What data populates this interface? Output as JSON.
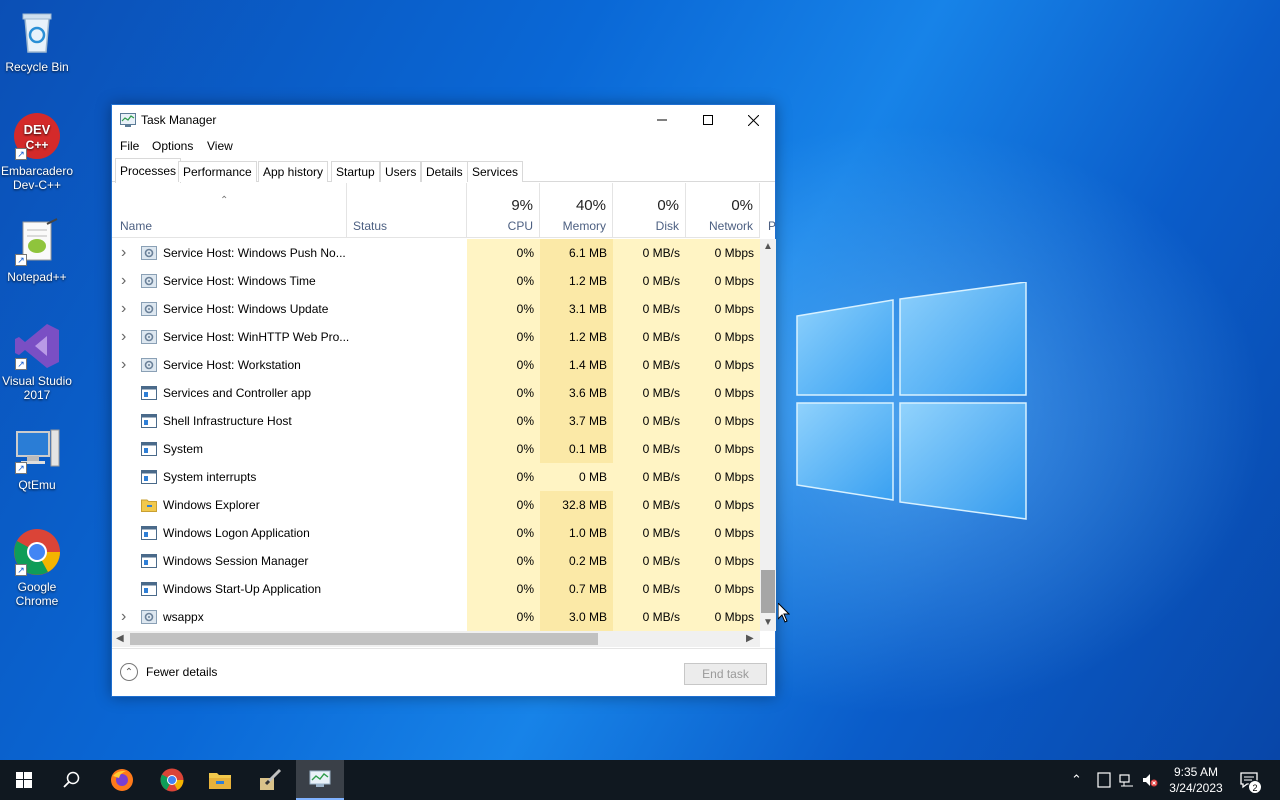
{
  "desktop": {
    "icons": [
      {
        "label": "Recycle Bin",
        "icon": "recycle-bin-icon"
      },
      {
        "label": "Embarcadero Dev-C++",
        "icon": "devcpp-icon"
      },
      {
        "label": "Notepad++",
        "icon": "notepadpp-icon"
      },
      {
        "label": "Visual Studio 2017",
        "icon": "visual-studio-icon"
      },
      {
        "label": "QtEmu",
        "icon": "qtemu-icon"
      },
      {
        "label": "Google Chrome",
        "icon": "chrome-icon"
      }
    ],
    "devcpp_logo_text": "DEV C++"
  },
  "window": {
    "title": "Task Manager",
    "menu": [
      "File",
      "Options",
      "View"
    ],
    "tabs": [
      "Processes",
      "Performance",
      "App history",
      "Startup",
      "Users",
      "Details",
      "Services"
    ],
    "active_tab": "Processes",
    "columns": {
      "name": "Name",
      "status": "Status",
      "cpu": {
        "label": "CPU",
        "pct": "9%"
      },
      "memory": {
        "label": "Memory",
        "pct": "40%"
      },
      "disk": {
        "label": "Disk",
        "pct": "0%"
      },
      "network": {
        "label": "Network",
        "pct": "0%"
      },
      "power_partial": "P"
    },
    "rows": [
      {
        "name": "Service Host: Windows Push No...",
        "expandable": true,
        "icon": "gear-icon",
        "cpu": "0%",
        "memory": "6.1 MB",
        "disk": "0 MB/s",
        "network": "0 Mbps"
      },
      {
        "name": "Service Host: Windows Time",
        "expandable": true,
        "icon": "gear-icon",
        "cpu": "0%",
        "memory": "1.2 MB",
        "disk": "0 MB/s",
        "network": "0 Mbps"
      },
      {
        "name": "Service Host: Windows Update",
        "expandable": true,
        "icon": "gear-icon",
        "cpu": "0%",
        "memory": "3.1 MB",
        "disk": "0 MB/s",
        "network": "0 Mbps"
      },
      {
        "name": "Service Host: WinHTTP Web Pro...",
        "expandable": true,
        "icon": "gear-icon",
        "cpu": "0%",
        "memory": "1.2 MB",
        "disk": "0 MB/s",
        "network": "0 Mbps"
      },
      {
        "name": "Service Host: Workstation",
        "expandable": true,
        "icon": "gear-icon",
        "cpu": "0%",
        "memory": "1.4 MB",
        "disk": "0 MB/s",
        "network": "0 Mbps"
      },
      {
        "name": "Services and Controller app",
        "expandable": false,
        "icon": "window-icon",
        "cpu": "0%",
        "memory": "3.6 MB",
        "disk": "0 MB/s",
        "network": "0 Mbps"
      },
      {
        "name": "Shell Infrastructure Host",
        "expandable": false,
        "icon": "window-icon",
        "cpu": "0%",
        "memory": "3.7 MB",
        "disk": "0 MB/s",
        "network": "0 Mbps"
      },
      {
        "name": "System",
        "expandable": false,
        "icon": "window-icon",
        "cpu": "0%",
        "memory": "0.1 MB",
        "disk": "0 MB/s",
        "network": "0 Mbps"
      },
      {
        "name": "System interrupts",
        "expandable": false,
        "icon": "window-icon",
        "cpu": "0%",
        "memory": "0 MB",
        "disk": "0 MB/s",
        "network": "0 Mbps",
        "light_memory": true
      },
      {
        "name": "Windows Explorer",
        "expandable": false,
        "icon": "folder-icon",
        "cpu": "0%",
        "memory": "32.8 MB",
        "disk": "0 MB/s",
        "network": "0 Mbps"
      },
      {
        "name": "Windows Logon Application",
        "expandable": false,
        "icon": "window-icon",
        "cpu": "0%",
        "memory": "1.0 MB",
        "disk": "0 MB/s",
        "network": "0 Mbps"
      },
      {
        "name": "Windows Session Manager",
        "expandable": false,
        "icon": "window-icon",
        "cpu": "0%",
        "memory": "0.2 MB",
        "disk": "0 MB/s",
        "network": "0 Mbps"
      },
      {
        "name": "Windows Start-Up Application",
        "expandable": false,
        "icon": "window-icon",
        "cpu": "0%",
        "memory": "0.7 MB",
        "disk": "0 MB/s",
        "network": "0 Mbps"
      },
      {
        "name": "wsappx",
        "expandable": true,
        "icon": "gear-icon",
        "cpu": "0%",
        "memory": "3.0 MB",
        "disk": "0 MB/s",
        "network": "0 Mbps"
      }
    ],
    "footer": {
      "fewer_details": "Fewer details",
      "end_task": "End task"
    }
  },
  "taskbar": {
    "items": [
      "start-icon",
      "search-icon",
      "firefox-icon",
      "chrome-icon",
      "file-explorer-icon",
      "pen-app-icon",
      "task-manager-icon"
    ],
    "clock": {
      "time": "9:35 AM",
      "date": "3/24/2023"
    },
    "notification_count": "2"
  },
  "colors": {
    "cpu_heat": "#fff4c4",
    "memory_heat": "#fbe9a7",
    "taskbar": "#101820",
    "accent": "#7fb2ff"
  }
}
